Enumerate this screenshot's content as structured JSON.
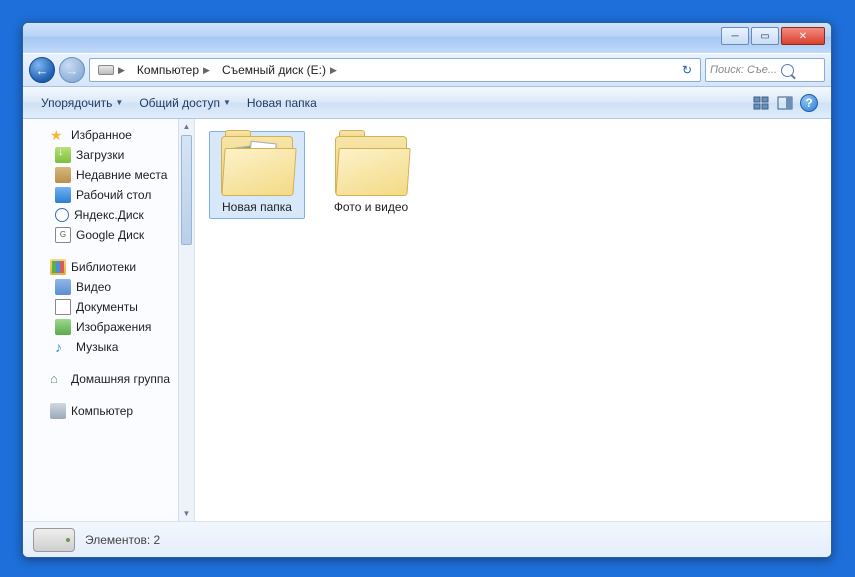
{
  "breadcrumb": {
    "seg1": "Компьютер",
    "seg2": "Съемный диск (E:)"
  },
  "search": {
    "placeholder": "Поиск: Съе..."
  },
  "toolbar": {
    "organize": "Упорядочить",
    "share": "Общий доступ",
    "newfolder": "Новая папка"
  },
  "sidebar": {
    "favorites": "Избранное",
    "downloads": "Загрузки",
    "recent": "Недавние места",
    "desktop": "Рабочий стол",
    "yandex": "Яндекс.Диск",
    "google": "Google Диск",
    "libraries": "Библиотеки",
    "video": "Видео",
    "documents": "Документы",
    "images": "Изображения",
    "music": "Музыка",
    "homegroup": "Домашняя группа",
    "computer": "Компьютер"
  },
  "items": [
    {
      "name": "Новая папка",
      "selected": true,
      "hasThumbs": true
    },
    {
      "name": "Фото и видео",
      "selected": false,
      "hasThumbs": false
    }
  ],
  "status": {
    "label": "Элементов: 2"
  }
}
